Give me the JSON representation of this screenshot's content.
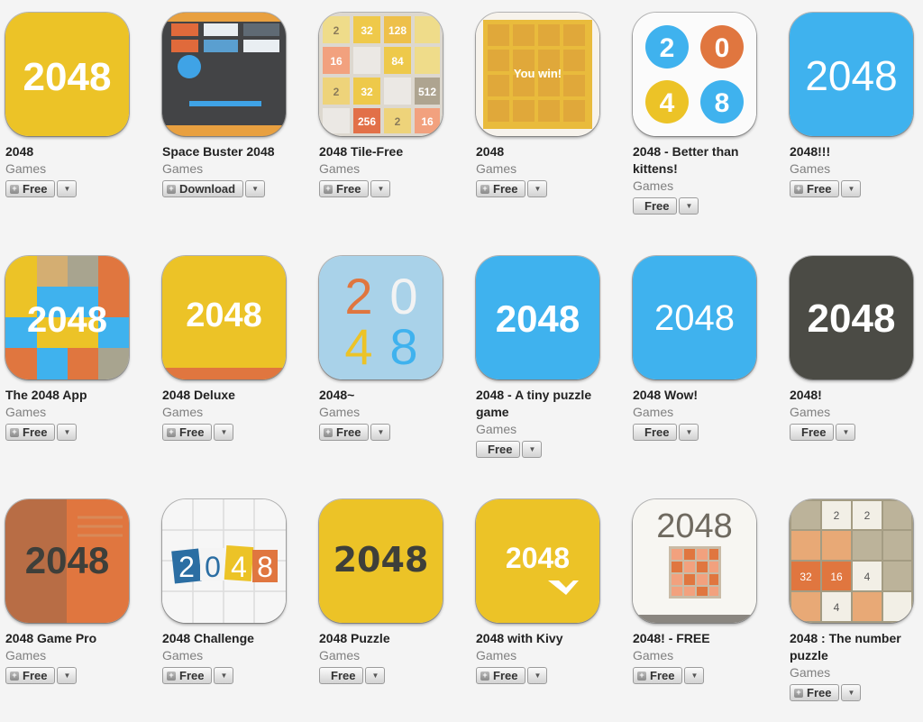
{
  "apps": [
    {
      "name": "2048",
      "category": "Games",
      "button": "Free",
      "plus": true,
      "icon": "yellow-2048-icon"
    },
    {
      "name": "Space Buster 2048",
      "category": "Games",
      "button": "Download",
      "plus": true,
      "icon": "space-buster-icon"
    },
    {
      "name": "2048 Tile-Free",
      "category": "Games",
      "button": "Free",
      "plus": true,
      "icon": "tile-board-icon",
      "tiles": [
        "2",
        "32",
        "128",
        "16",
        "",
        "84",
        "2",
        "32",
        "512",
        "256",
        "2",
        "16"
      ]
    },
    {
      "name": "2048",
      "category": "Games",
      "button": "Free",
      "plus": true,
      "icon": "you-win-board-icon",
      "overlay": "You win!"
    },
    {
      "name": "2048 - Better than kittens!",
      "category": "Games",
      "button": "Free",
      "plus": false,
      "icon": "circles-2048-icon",
      "digits": [
        "2",
        "0",
        "4",
        "8"
      ]
    },
    {
      "name": "2048!!!",
      "category": "Games",
      "button": "Free",
      "plus": true,
      "icon": "blue-2048-icon"
    },
    {
      "name": "The 2048 App",
      "category": "Games",
      "button": "Free",
      "plus": true,
      "icon": "mosaic-2048-icon"
    },
    {
      "name": "2048 Deluxe",
      "category": "Games",
      "button": "Free",
      "plus": true,
      "icon": "deluxe-2048-icon"
    },
    {
      "name": "2048~",
      "category": "Games",
      "button": "Free",
      "plus": true,
      "icon": "colored-digits-icon",
      "digits": [
        "2",
        "0",
        "4",
        "8"
      ]
    },
    {
      "name": "2048 - A tiny puzzle game",
      "category": "Games",
      "button": "Free",
      "plus": false,
      "icon": "blue-bold-2048-icon"
    },
    {
      "name": "2048 Wow!",
      "category": "Games",
      "button": "Free",
      "plus": false,
      "icon": "blue-thin-2048-icon"
    },
    {
      "name": "2048!",
      "category": "Games",
      "button": "Free",
      "plus": false,
      "icon": "dark-2048-icon"
    },
    {
      "name": "2048 Game Pro",
      "category": "Games",
      "button": "Free",
      "plus": true,
      "icon": "game-pro-icon"
    },
    {
      "name": "2048 Challenge",
      "category": "Games",
      "button": "Free",
      "plus": true,
      "icon": "challenge-icon",
      "digits": [
        "2",
        "0",
        "4",
        "8"
      ]
    },
    {
      "name": "2048 Puzzle",
      "category": "Games",
      "button": "Free",
      "plus": false,
      "icon": "puzzle-2048-icon"
    },
    {
      "name": "2048 with Kivy",
      "category": "Games",
      "button": "Free",
      "plus": true,
      "icon": "kivy-2048-icon"
    },
    {
      "name": "2048! - FREE",
      "category": "Games",
      "button": "Free",
      "plus": true,
      "icon": "board-2048-free-icon"
    },
    {
      "name": "2048 : The number puzzle",
      "category": "Games",
      "button": "Free",
      "plus": true,
      "icon": "number-puzzle-icon",
      "tiles": [
        "2",
        "2",
        "32",
        "16",
        "4",
        "4"
      ]
    }
  ],
  "icon_text": "2048",
  "colors": {
    "yellow": "#ecc327",
    "blue": "#3fb2ee",
    "dark": "#4b4b45",
    "orange": "#e0763f",
    "sky": "#a9d2e9"
  }
}
